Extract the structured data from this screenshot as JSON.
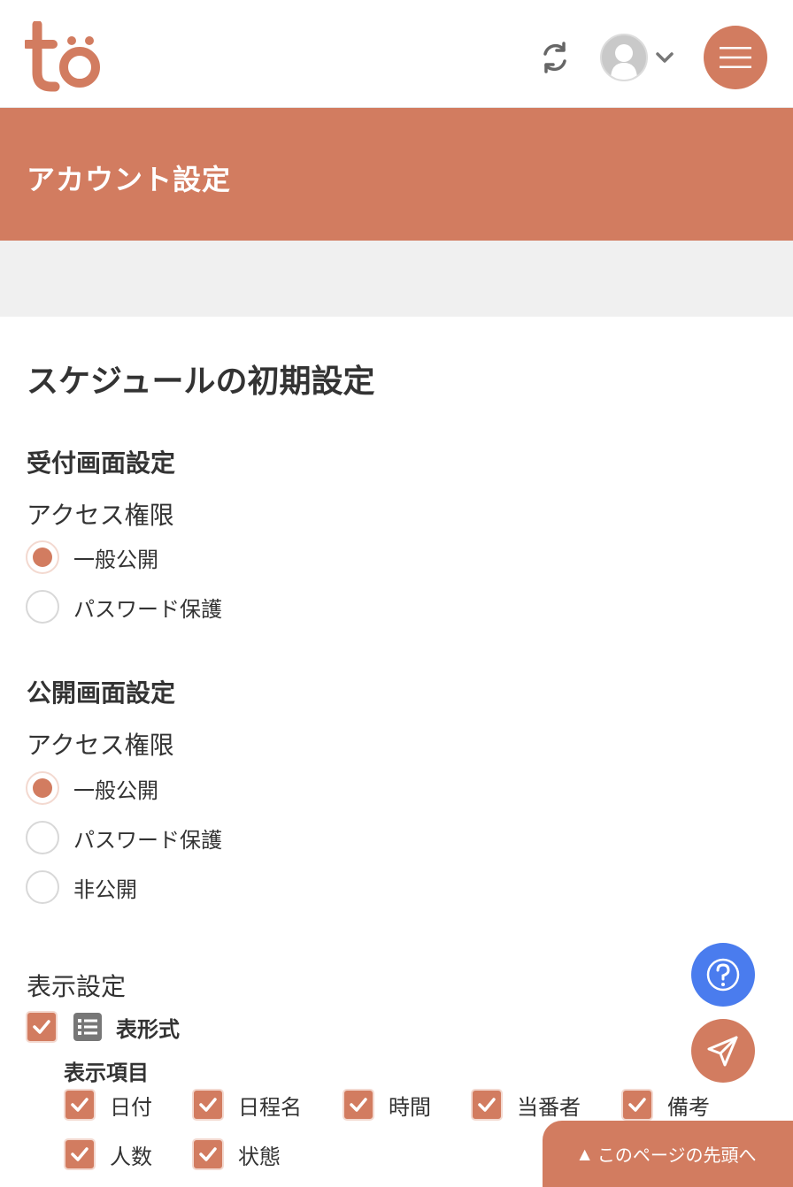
{
  "header": {
    "logo_text": "to",
    "sync_icon": "sync-icon",
    "avatar_icon": "user-avatar-icon",
    "menu_icon": "hamburger-menu-icon"
  },
  "page": {
    "title": "アカウント設定",
    "section_title": "スケジュールの初期設定"
  },
  "reception": {
    "heading": "受付画面設定",
    "access_label": "アクセス権限",
    "options": [
      "一般公開",
      "パスワード保護"
    ],
    "selected": "一般公開"
  },
  "public": {
    "heading": "公開画面設定",
    "access_label": "アクセス権限",
    "options": [
      "一般公開",
      "パスワード保護",
      "非公開"
    ],
    "selected": "一般公開"
  },
  "display": {
    "heading": "表示設定",
    "table_format_label": "表形式",
    "table_format_checked": true,
    "items_label": "表示項目",
    "items": [
      {
        "label": "日付",
        "checked": true
      },
      {
        "label": "日程名",
        "checked": true
      },
      {
        "label": "時間",
        "checked": true
      },
      {
        "label": "当番者",
        "checked": true
      },
      {
        "label": "備考",
        "checked": true
      },
      {
        "label": "人数",
        "checked": true
      },
      {
        "label": "状態",
        "checked": true
      }
    ]
  },
  "floating": {
    "help_icon": "help-question-icon",
    "send_icon": "send-paper-plane-icon",
    "to_top_label": "このページの先頭へ",
    "to_top_arrow": "▲"
  },
  "colors": {
    "brand": "#d27c60",
    "help": "#4a7cee",
    "band_grey": "#f0f0f0"
  }
}
